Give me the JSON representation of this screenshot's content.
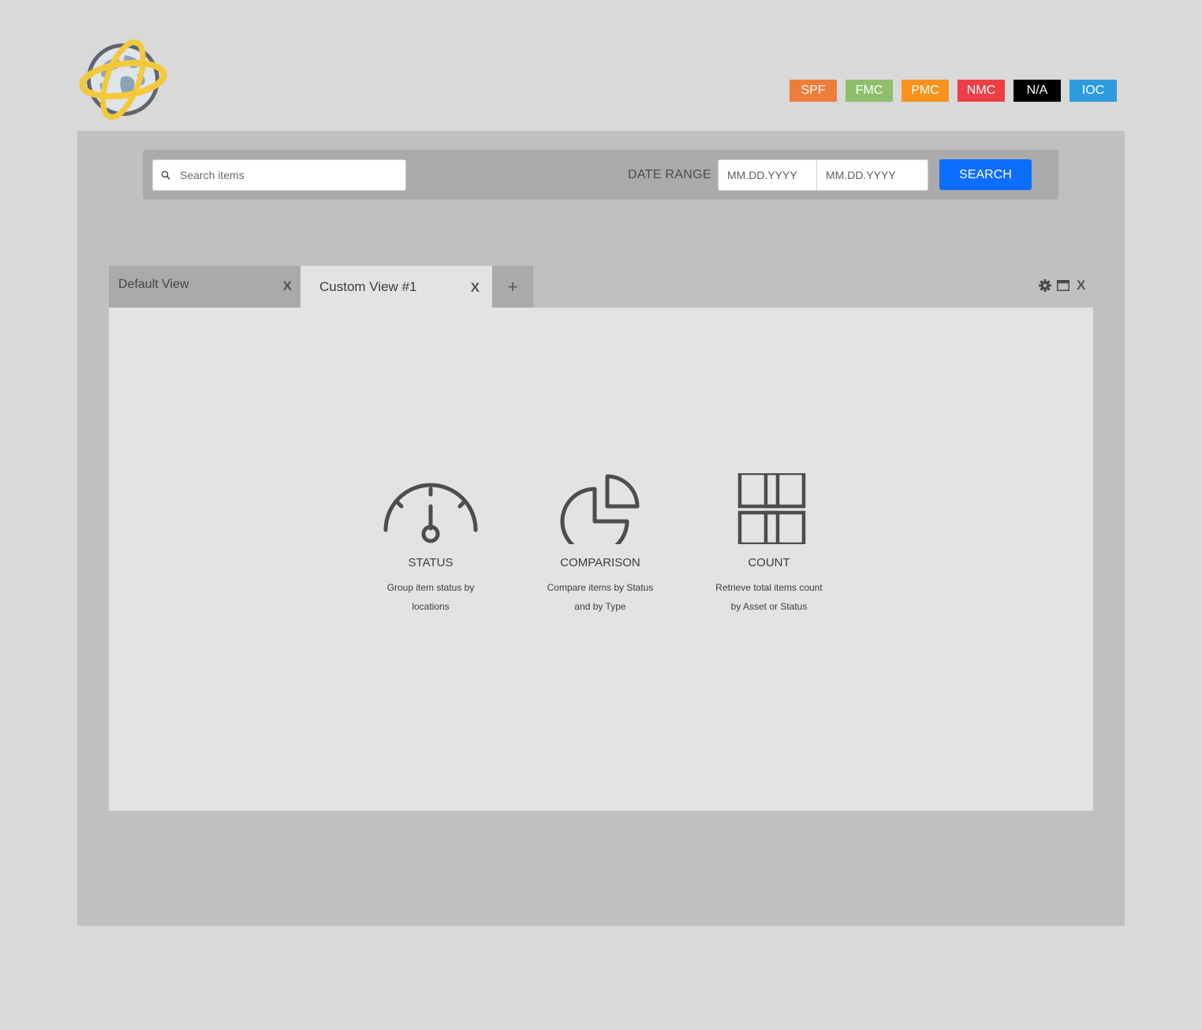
{
  "legend": [
    {
      "label": "SPF",
      "color": "#ed7d3a"
    },
    {
      "label": "FMC",
      "color": "#8fbf6a"
    },
    {
      "label": "PMC",
      "color": "#f7931e"
    },
    {
      "label": "NMC",
      "color": "#ef3d45"
    },
    {
      "label": "N/A",
      "color": "#000000"
    },
    {
      "label": "IOC",
      "color": "#2e9bde"
    }
  ],
  "search": {
    "placeholder": "Search items",
    "date_range_label": "DATE RANGE",
    "date_from_placeholder": "MM.DD.YYYY",
    "date_to_placeholder": "MM.DD.YYYY",
    "button_label": "SEARCH"
  },
  "tabs": [
    {
      "label": "Default View",
      "close": "X"
    },
    {
      "label": "Custom View #1",
      "close": "X"
    }
  ],
  "add_tab": "+",
  "window_close": "X",
  "widgets": [
    {
      "title": "STATUS",
      "desc_line1": "Group item status by",
      "desc_line2": "locations",
      "icon": "gauge-icon"
    },
    {
      "title": "COMPARISON",
      "desc_line1": "Compare items by Status",
      "desc_line2": "and by Type",
      "icon": "pie-chart-icon"
    },
    {
      "title": "COUNT",
      "desc_line1": "Retrieve total items count",
      "desc_line2": "by Asset or Status",
      "icon": "grid-icon"
    }
  ]
}
